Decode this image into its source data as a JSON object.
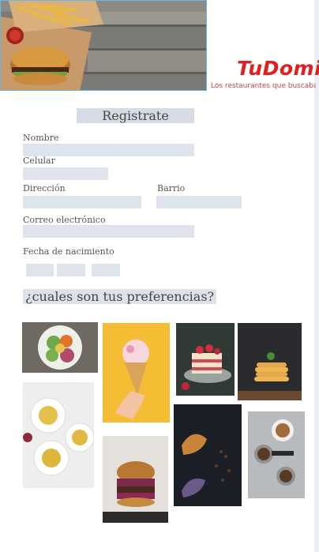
{
  "brand": {
    "logo": "TuDomi",
    "tagline": "Los restaurantes que buscabas est"
  },
  "form": {
    "title": "Registrate",
    "name_label": "Nombre",
    "phone_label": "Celular",
    "address_label": "Dirección",
    "neighborhood_label": "Barrio",
    "email_label": "Correo electrónico",
    "birthdate_label": "Fecha de nacimiento"
  },
  "preferences": {
    "title": "¿cuales son tus preferencias?",
    "options": [
      "salad-bowl",
      "ice-cream-cone",
      "strawberry-cake",
      "pancake-stack",
      "pasta-plates",
      "burger",
      "croissant",
      "coffee-beans"
    ]
  },
  "colors": {
    "brand_red": "#e0201f",
    "field_bg": "#dfe3ee"
  }
}
